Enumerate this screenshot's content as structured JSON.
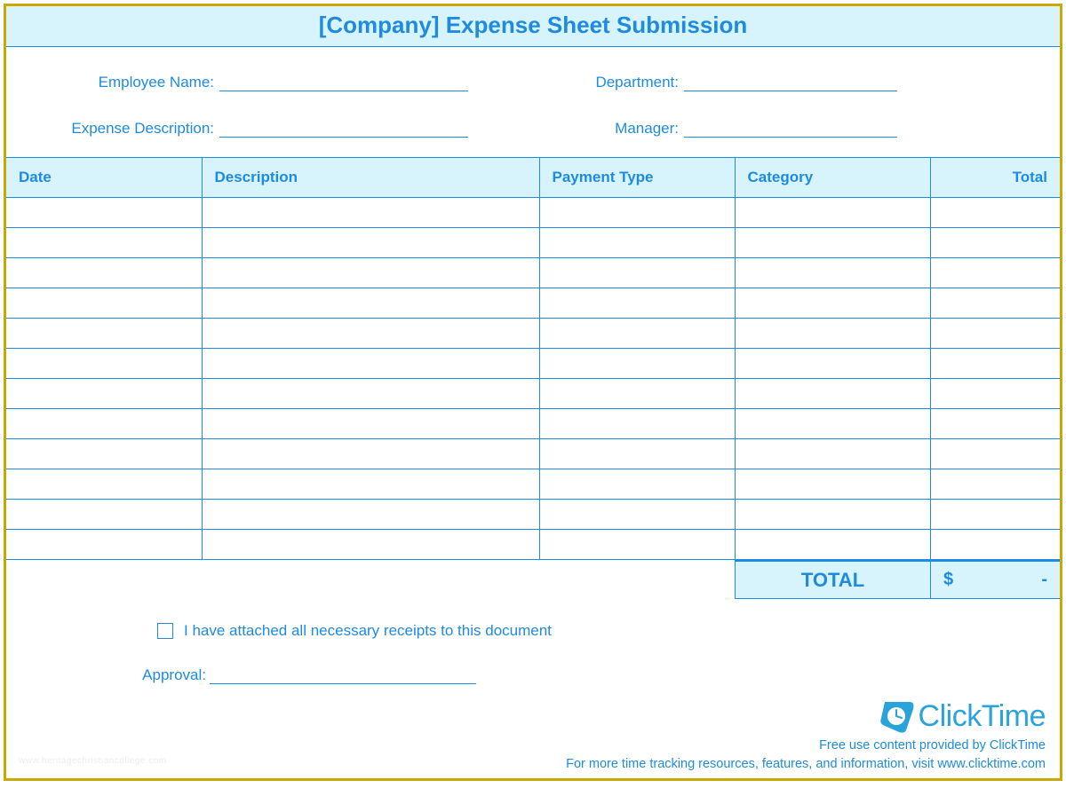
{
  "title": "[Company] Expense Sheet Submission",
  "fields": {
    "employee_name": "Employee Name:",
    "expense_description": "Expense Description:",
    "department": "Department:",
    "manager": "Manager:"
  },
  "table": {
    "headers": {
      "date": "Date",
      "description": "Description",
      "payment_type": "Payment Type",
      "category": "Category",
      "total": "Total"
    },
    "row_count": 12
  },
  "totals": {
    "label": "TOTAL",
    "currency": "$",
    "value": "-"
  },
  "receipts_text": "I have attached all necessary receipts to this document",
  "approval_label": "Approval:",
  "logo_text": "ClickTime",
  "footer_line1": "Free use content provided by ClickTime",
  "footer_line2": "For more time tracking resources, features, and information, visit www.clicktime.com",
  "watermark": "www.heritagechristiancollege.com"
}
